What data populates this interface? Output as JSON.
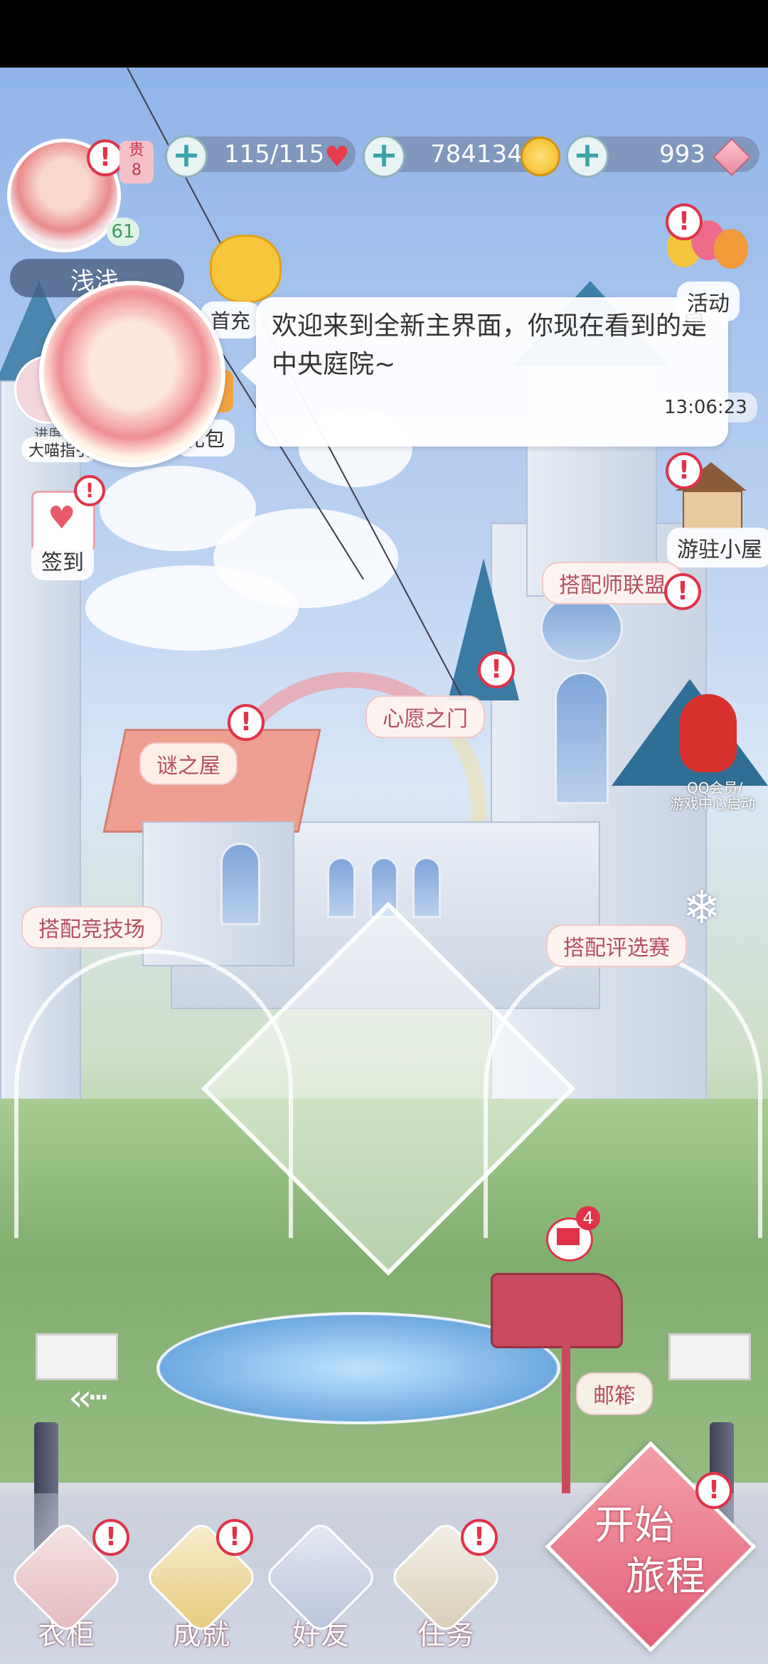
{
  "topbar": {
    "stamina": "115/115",
    "gold": "784134",
    "diamonds": "993"
  },
  "player": {
    "level": "61",
    "name": "浅浅",
    "vip_label": "贵",
    "vip_level": "8"
  },
  "dialog": {
    "text": "欢迎来到全新主界面，你现在看到的是中央庭院~"
  },
  "left_menu": {
    "first_recharge": "首充",
    "gift_pack": "礼包",
    "progress": "进度",
    "guide": "大喵指引",
    "signin": "签到"
  },
  "right_menu": {
    "activity": "活动",
    "timer": "13:06:23",
    "cabin": "游驻小屋",
    "qq_label_1": "QQ会员/",
    "qq_label_2": "游戏中心启动"
  },
  "scene_signs": {
    "stylist_union": "搭配师联盟",
    "wish_gate": "心愿之门",
    "mystery_house": "谜之屋",
    "arena": "搭配竞技场",
    "selection": "搭配评选赛",
    "mailbox": "邮箱"
  },
  "mail_badge": "4",
  "bottom_nav": [
    {
      "label": "衣柜"
    },
    {
      "label": "成就"
    },
    {
      "label": "好友"
    },
    {
      "label": "任务"
    }
  ],
  "start_button": {
    "line1": "开始",
    "line2": "旅程"
  },
  "colors": {
    "alert": "#e0334a",
    "heart": "#e63c4b",
    "coin": "#f2b51c",
    "diamond": "#e88aa0"
  }
}
